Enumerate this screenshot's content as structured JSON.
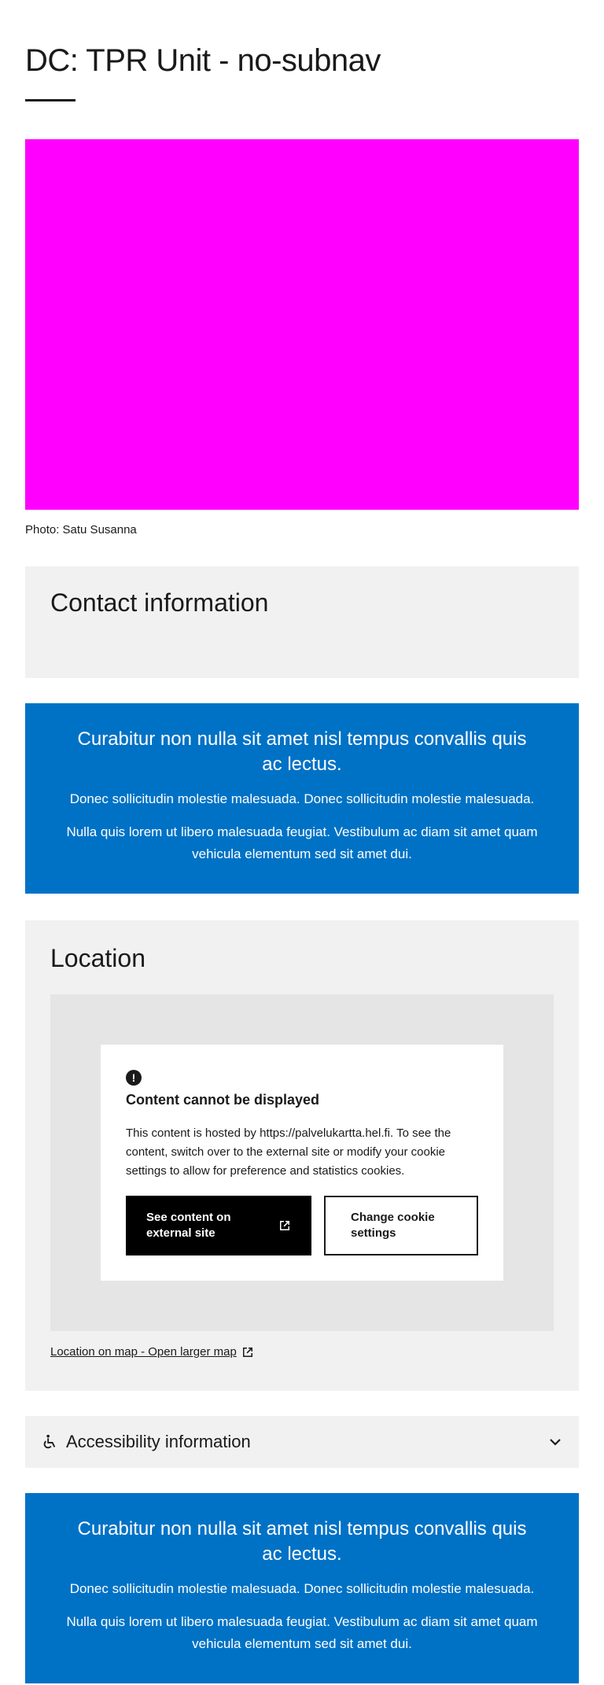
{
  "page": {
    "title": "DC: TPR Unit - no-subnav"
  },
  "hero": {
    "caption": "Photo: Satu Susanna",
    "color": "#ff00ff"
  },
  "contact": {
    "heading": "Contact information"
  },
  "banner_1": {
    "title": "Curabitur non nulla sit amet nisl tempus convallis quis ac lectus.",
    "paragraph_1": "Donec sollicitudin molestie malesuada. Donec sollicitudin molestie malesuada.",
    "paragraph_2": "Nulla quis lorem ut libero malesuada feugiat. Vestibulum ac diam sit amet quam vehicula elementum sed sit amet dui."
  },
  "location": {
    "heading": "Location",
    "consent": {
      "icon": "alert-circle-icon",
      "title": "Content cannot be displayed",
      "text": "This content is hosted by https://palvelukartta.hel.fi. To see the content, switch over to the external site or modify your cookie settings to allow for preference and statistics cookies.",
      "primary_button": "See content on external site",
      "secondary_button": "Change cookie settings"
    },
    "map_link": "Location on map - Open larger map"
  },
  "accessibility": {
    "title": "Accessibility information",
    "icon": "wheelchair-icon"
  },
  "banner_2": {
    "title": "Curabitur non nulla sit amet nisl tempus convallis quis ac lectus.",
    "paragraph_1": "Donec sollicitudin molestie malesuada. Donec sollicitudin molestie malesuada.",
    "paragraph_2": "Nulla quis lorem ut libero malesuada feugiat. Vestibulum ac diam sit amet quam vehicula elementum sed sit amet dui."
  },
  "colors": {
    "brand_blue": "#0072c6",
    "panel_gray": "#f1f1f1",
    "map_gray": "#e5e5e5"
  }
}
